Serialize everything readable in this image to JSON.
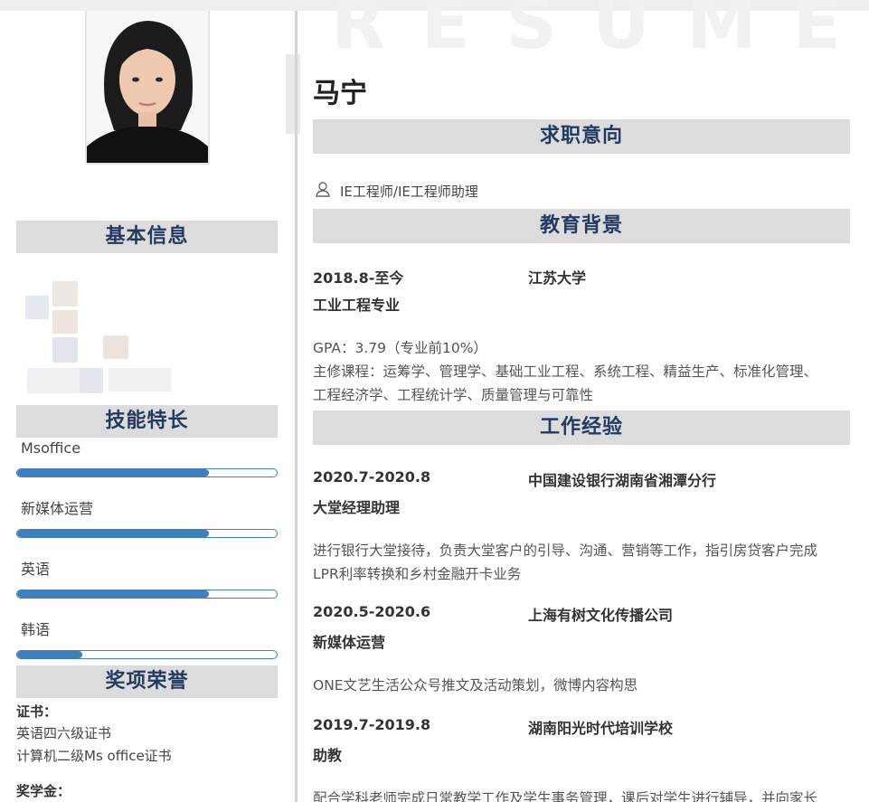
{
  "watermark": "RESUME",
  "name": "马宁",
  "left": {
    "basic_info_title": "基本信息",
    "skills_title": "技能特长",
    "skills": [
      {
        "name": "Msoffice",
        "level": 0.74
      },
      {
        "name": "新媒体运营",
        "level": 0.74
      },
      {
        "name": "英语",
        "level": 0.74
      },
      {
        "name": "韩语",
        "level": 0.25
      }
    ],
    "awards_title": "奖项荣誉",
    "cert_label": "证书：",
    "certs": [
      "英语四六级证书",
      "计算机二级Ms office证书"
    ],
    "scholarship_label": "奖学金："
  },
  "intent": {
    "title": "求职意向",
    "position": "IE工程师/IE工程师助理",
    "icon": "person-icon"
  },
  "education": {
    "title": "教育背景",
    "date": "2018.8-至今",
    "school": "江苏大学",
    "major": "工业工程专业",
    "gpa": "GPA：3.79（专业前10%）",
    "courses_1": "主修课程：运筹学、管理学、基础工业工程、系统工程、精益生产、标准化管理、",
    "courses_2": "工程经济学、工程统计学、质量管理与可靠性"
  },
  "work": {
    "title": "工作经验",
    "items": [
      {
        "date": "2020.7-2020.8",
        "org": "中国建设银行湖南省湘潭分行",
        "role": "大堂经理助理",
        "desc_1": "进行银行大堂接待，负责大堂客户的引导、沟通、营销等工作，指引房贷客户完成",
        "desc_2": "LPR利率转换和乡村金融开卡业务"
      },
      {
        "date": "2020.5-2020.6",
        "org": "上海有树文化传播公司",
        "role": "新媒体运营",
        "desc_1": "ONE文艺生活公众号推文及活动策划，微博内容构思"
      },
      {
        "date": "2019.7-2019.8",
        "org": "湖南阳光时代培训学校",
        "role": "助教",
        "desc_1": "配合学科老师完成日常教学工作及学生事务管理，课后对学生进行辅导，并向家长"
      }
    ]
  },
  "colors": {
    "accent": "#223b63",
    "bar": "#3e7fbd",
    "section_bg": "#dcdcdc"
  }
}
